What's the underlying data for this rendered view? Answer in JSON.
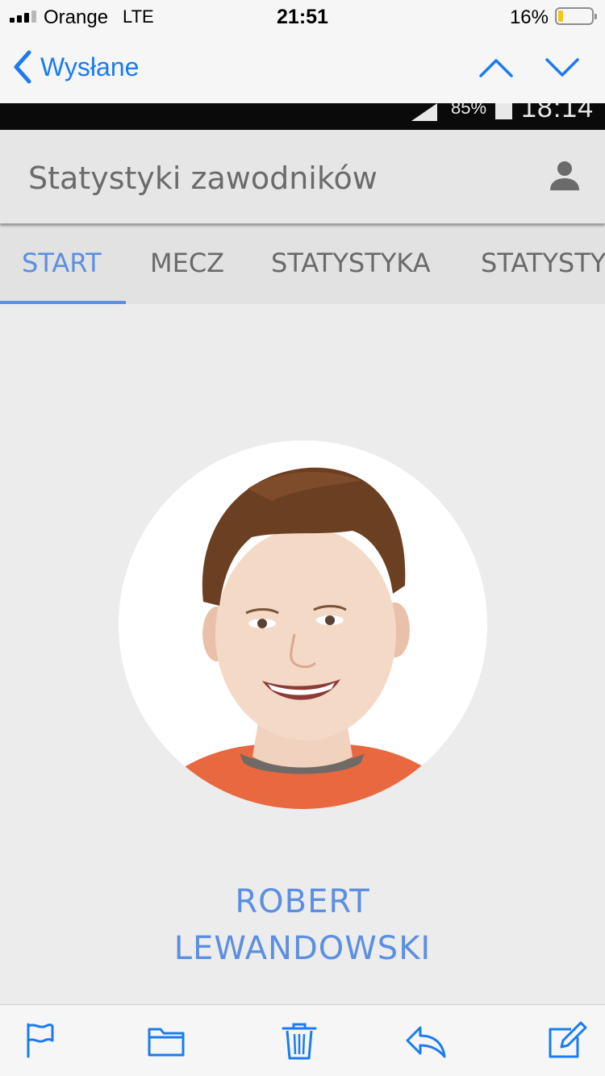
{
  "status_bar": {
    "carrier": "Orange",
    "network": "LTE",
    "time": "21:51",
    "battery_percent": "16%",
    "battery_level": 0.16
  },
  "mail_nav": {
    "back_label": "Wysłane",
    "icons": [
      "chevron-left-icon",
      "chevron-up-icon",
      "chevron-down-icon"
    ],
    "accent_color": "#1a7cf0"
  },
  "inner_status": {
    "battery_percent": "85%",
    "time": "18:14"
  },
  "app": {
    "title": "Statystyki zawodników",
    "account_icon": "person-icon",
    "tabs": [
      {
        "label": "START",
        "active": true
      },
      {
        "label": "MECZ",
        "active": false
      },
      {
        "label": "STATYSTYKA",
        "active": false
      },
      {
        "label": "STATYSTYKI",
        "active": false
      }
    ],
    "accent_color": "#5b8fe1"
  },
  "player": {
    "first_name": "ROBERT",
    "last_name": "LEWANDOWSKI",
    "photo": "player-photo"
  },
  "toolbar": {
    "icons": [
      "flag-icon",
      "folder-icon",
      "trash-icon",
      "reply-icon",
      "compose-icon"
    ]
  }
}
